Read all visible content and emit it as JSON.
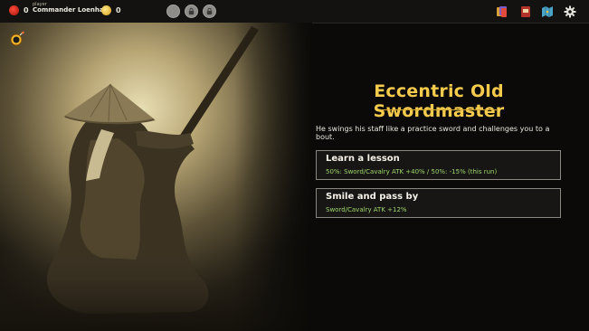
{
  "player": {
    "role": "player",
    "name": "Commander Loenhart"
  },
  "resources": [
    {
      "icon": "red-ribbon-icon",
      "value": "0"
    },
    {
      "icon": "gold-coin-icon",
      "value": "0"
    }
  ],
  "slots": [
    {
      "icon": "empty-slot-icon"
    },
    {
      "icon": "lock-icon"
    },
    {
      "icon": "lock-icon"
    }
  ],
  "toolbar": [
    {
      "icon": "cards-icon"
    },
    {
      "icon": "book-icon"
    },
    {
      "icon": "map-icon"
    },
    {
      "icon": "gear-icon"
    }
  ],
  "event": {
    "title": "Eccentric Old Swordmaster",
    "description": "He swings his staff like a practice sword and challenges you to a bout.",
    "choices": [
      {
        "label": "Learn a lesson",
        "effect": "50%: Sword/Cavalry ATK +40% / 50%: -15% (this run)"
      },
      {
        "label": "Smile and pass by",
        "effect": "Sword/Cavalry ATK +12%"
      }
    ]
  },
  "colors": {
    "title": "#f4cb4c",
    "effect": "#9fd76b",
    "background": "#0b0a08"
  }
}
